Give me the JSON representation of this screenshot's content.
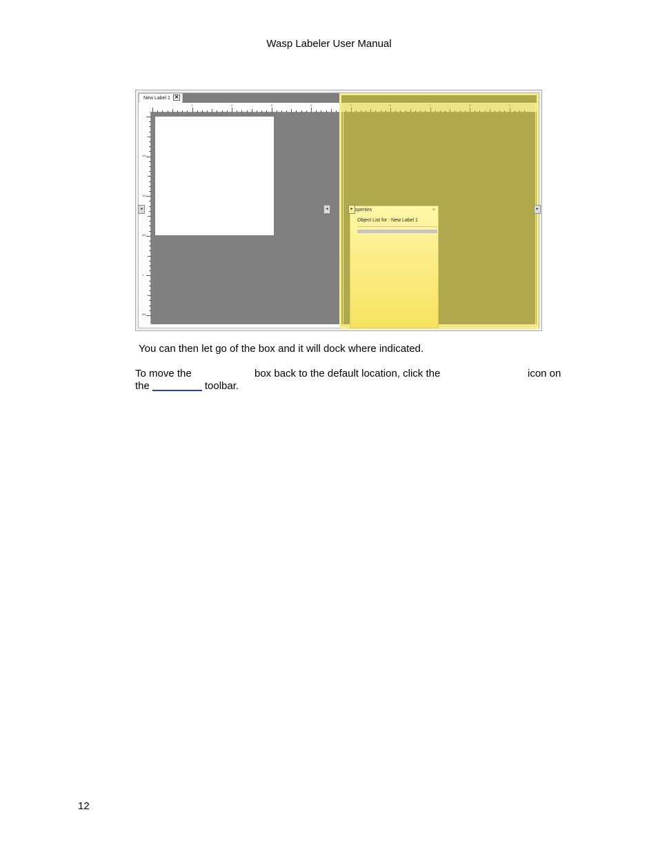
{
  "header": {
    "title": "Wasp Labeler User Manual"
  },
  "screenshot": {
    "tab_label": "New Label 1",
    "tab_close_glyph": "✕",
    "ruler_top_numbers": [
      "1",
      "2",
      "3",
      "4",
      "5",
      "6",
      "7",
      "8",
      "9"
    ],
    "ruler_left_numbers": [
      "1/4",
      "1/2",
      "3/4",
      "1",
      "5/4"
    ],
    "handle_left_glyph": "◂",
    "handle_mid_glyph": "◂",
    "handle_panel_glyph": "▸",
    "handle_right_glyph": "▸",
    "panel_title": "roperties",
    "panel_close_glyph": "×",
    "panel_subtitle": "Object List for :  New Label 1",
    "accent_color": "#dccd1e"
  },
  "body": {
    "para1": "You can then let go of the box and it will dock where indicated.",
    "para2_part1": "To move the",
    "para2_part2": "box back to the default location, click the",
    "para2_part3": "icon on",
    "para2_line2_a": "the",
    "para2_line2_b": "toolbar."
  },
  "footer": {
    "page_number": "12"
  }
}
